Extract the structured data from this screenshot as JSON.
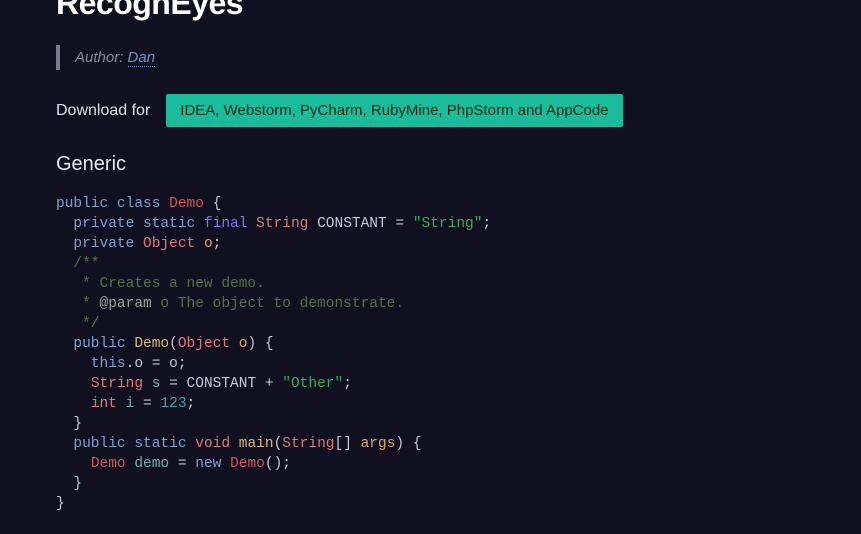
{
  "title": "RecognEyes",
  "author": {
    "label": "Author:",
    "name": "Dan"
  },
  "download": {
    "label": "Download for",
    "button": "IDEA, Webstorm, PyCharm, RubyMine, PhpStorm and AppCode"
  },
  "section": "Generic",
  "code": {
    "kw_public": "public",
    "kw_class": "class",
    "cls_demo": "Demo",
    "brace_open": " {",
    "kw_private": "private",
    "kw_static": "static",
    "kw_final": "final",
    "typ_string": "String",
    "typ_string2": "String",
    "typ_string3": "String",
    "typ_string4": "String",
    "const_name": " CONSTANT ",
    "eq": "= ",
    "str_string": "\"String\"",
    "semi": ";",
    "typ_object": "Object",
    "typ_object2": "Object",
    "space": " ",
    "var_o": "o",
    "cmt_open": "/**",
    "cmt_line1": " * Creates a new demo.",
    "cmt_param": " * ",
    "ann_param": "@param",
    "cmt_param_rest": " o The object to demonstrate.",
    "cmt_close": " */",
    "fn_demo": "Demo",
    "paren_open": "(",
    "paren_close": ")",
    "brace_open2": " {",
    "kw_this": "this",
    "dot": ".",
    "assign_o": "o = o;",
    "var_s": "s",
    "eq2": " = ",
    "const_ref": "CONSTANT",
    "plus": " + ",
    "str_other": "\"Other\"",
    "typ_int": "int",
    "var_i": "i",
    "num_123": "123",
    "brace_close": "}",
    "typ_void": "void",
    "fn_main": "main",
    "array": "[] ",
    "var_args": "args",
    "cls_demo2": "Demo",
    "var_demo": "demo",
    "kw_new": "new",
    "cls_demo3": "Demo",
    "empty_parens": "();"
  }
}
